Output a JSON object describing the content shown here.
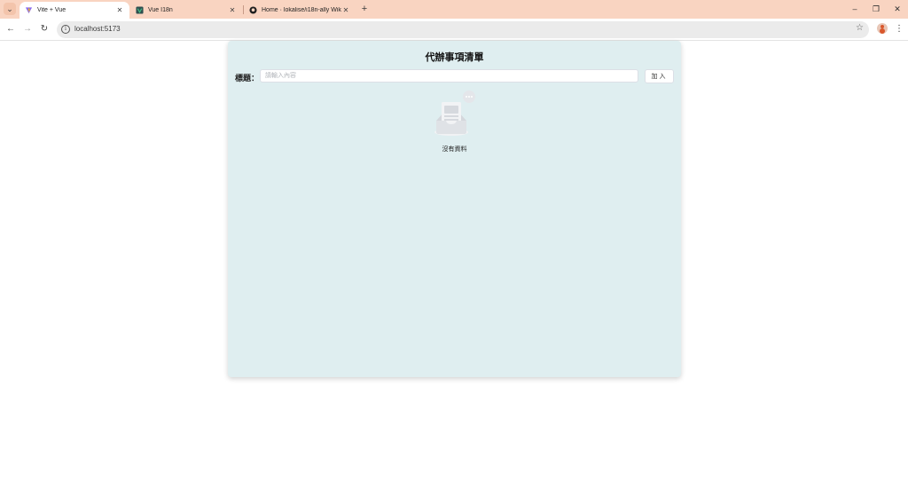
{
  "browser": {
    "tab_list_icon": "chevron-down-icon",
    "tabs": [
      {
        "title": "Vite + Vue",
        "icon": "vite-icon",
        "active": true
      },
      {
        "title": "Vue I18n",
        "icon": "vue-i18n-icon",
        "active": false
      },
      {
        "title": "Home · lokalise/i18n-ally Wiki",
        "icon": "github-icon",
        "active": false
      }
    ],
    "new_tab_label": "+",
    "url": "localhost:5173",
    "window_controls": {
      "minimize": "–",
      "restore": "❐",
      "close": "✕"
    },
    "nav": {
      "back": "←",
      "forward": "→",
      "reload": "↻"
    }
  },
  "app": {
    "title": "代辦事項清單",
    "form": {
      "label": "標題：",
      "placeholder": "請輸入內容",
      "value": "",
      "add_button": "加入"
    },
    "empty_state": {
      "icon": "empty-inbox-icon",
      "text": "沒有資料"
    }
  },
  "colors": {
    "tab_strip": "#f9d4c1",
    "card_background": "#dfeef0",
    "page_background": "#ffffff"
  }
}
